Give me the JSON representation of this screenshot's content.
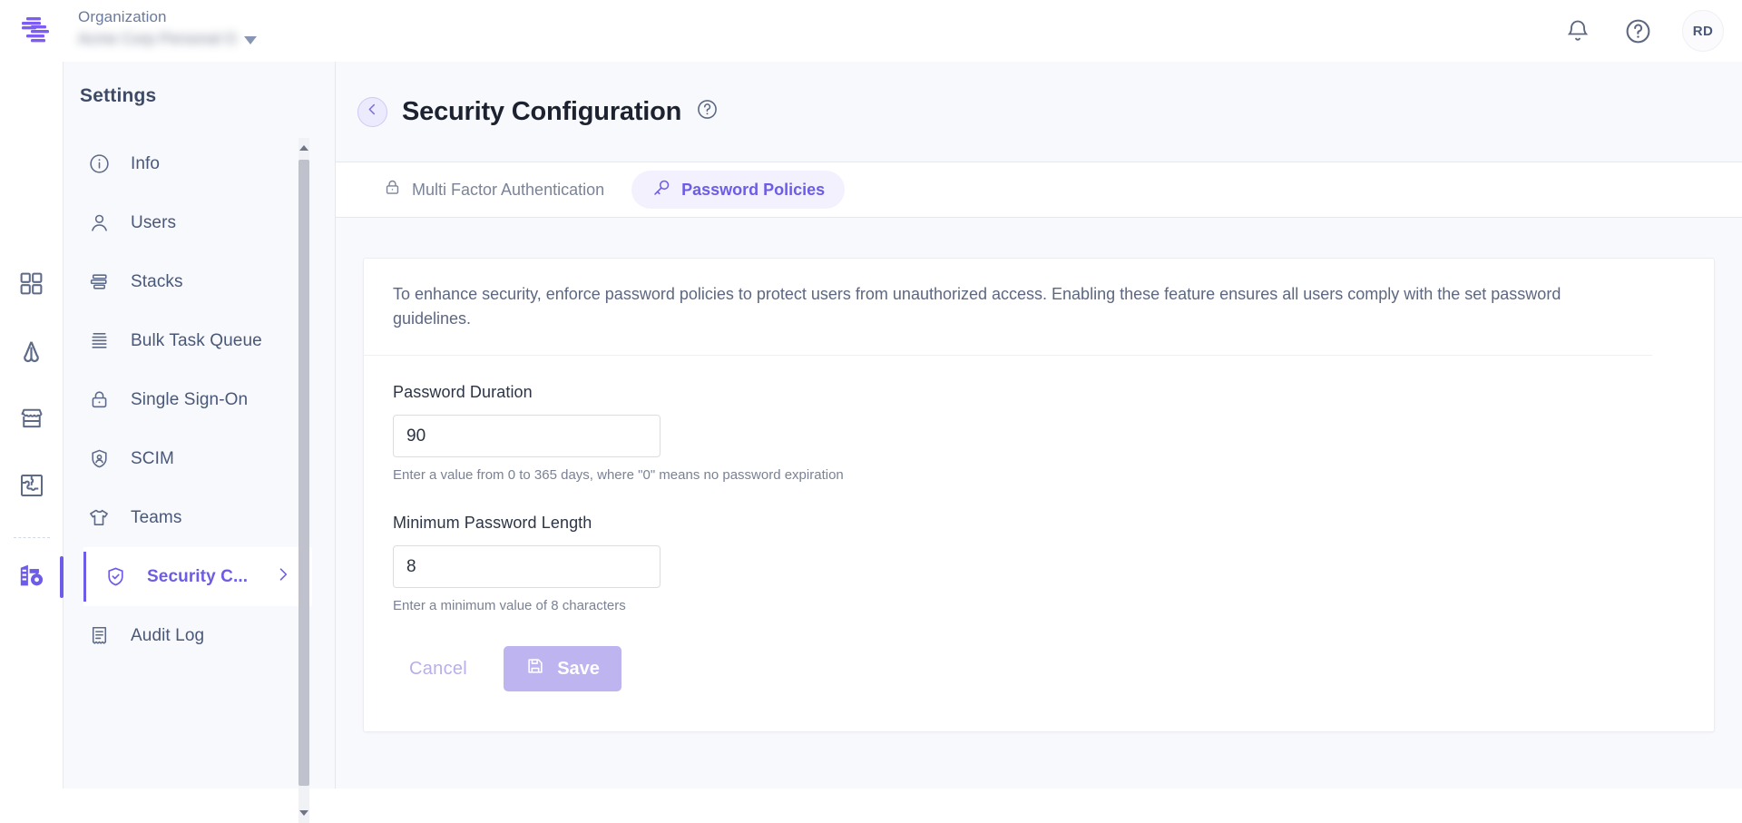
{
  "topbar": {
    "org_label": "Organization",
    "org_name": "Acme Corp Personal O",
    "caret_icon": "chevron-down-icon",
    "bell_icon": "notification-bell-icon",
    "help_icon": "help-circle-icon",
    "avatar_initials": "RD"
  },
  "rail": {
    "items": [
      {
        "icon": "grid-dashboard-icon",
        "name": "dashboard",
        "active": false
      },
      {
        "icon": "compass-arrow-icon",
        "name": "flows",
        "active": false
      },
      {
        "icon": "storefront-icon",
        "name": "marketplace",
        "active": false
      },
      {
        "icon": "puzzle-piece-icon",
        "name": "integrations",
        "active": false
      },
      {
        "icon": "building-gear-icon",
        "name": "organization-settings",
        "active": true
      }
    ]
  },
  "settings": {
    "title": "Settings",
    "items": [
      {
        "label": "Info",
        "icon": "info-circle-icon",
        "active": false
      },
      {
        "label": "Users",
        "icon": "user-icon",
        "active": false
      },
      {
        "label": "Stacks",
        "icon": "stacks-icon",
        "active": false
      },
      {
        "label": "Bulk Task Queue",
        "icon": "list-lines-icon",
        "active": false
      },
      {
        "label": "Single Sign-On",
        "icon": "padlock-icon",
        "active": false
      },
      {
        "label": "SCIM",
        "icon": "shield-user-icon",
        "active": false
      },
      {
        "label": "Teams",
        "icon": "tshirt-icon",
        "active": false
      },
      {
        "label": "Security C...",
        "icon": "shield-check-icon",
        "active": true,
        "chevron": "chevron-right-icon"
      },
      {
        "label": "Audit Log",
        "icon": "receipt-icon",
        "active": false
      }
    ]
  },
  "page": {
    "back_icon": "chevron-left-icon",
    "title": "Security Configuration",
    "help_icon": "help-circle-icon",
    "tabs": [
      {
        "label": "Multi Factor Authentication",
        "icon": "padlock-icon",
        "active": false
      },
      {
        "label": "Password Policies",
        "icon": "key-icon",
        "active": true
      }
    ]
  },
  "form": {
    "intro": "To enhance security, enforce password policies to protect users from unauthorized access. Enabling these feature ensures all users comply with the set password guidelines.",
    "fields": [
      {
        "label": "Password Duration",
        "value": "90",
        "placeholder": "90",
        "help": "Enter a value from 0 to 365 days, where \"0\" means no password expiration"
      },
      {
        "label": "Minimum Password Length",
        "value": "8",
        "placeholder": "8",
        "help": "Enter a minimum value of 8 characters"
      }
    ],
    "cancel_label": "Cancel",
    "save_label": "Save",
    "save_icon": "floppy-disk-save-icon"
  },
  "colors": {
    "accent": "#6c5ce7",
    "accent_soft": "#f3f1fe",
    "save_disabled": "#bdb4f0",
    "text_muted": "#7b8398",
    "panel_bg": "#f8f9fc"
  }
}
